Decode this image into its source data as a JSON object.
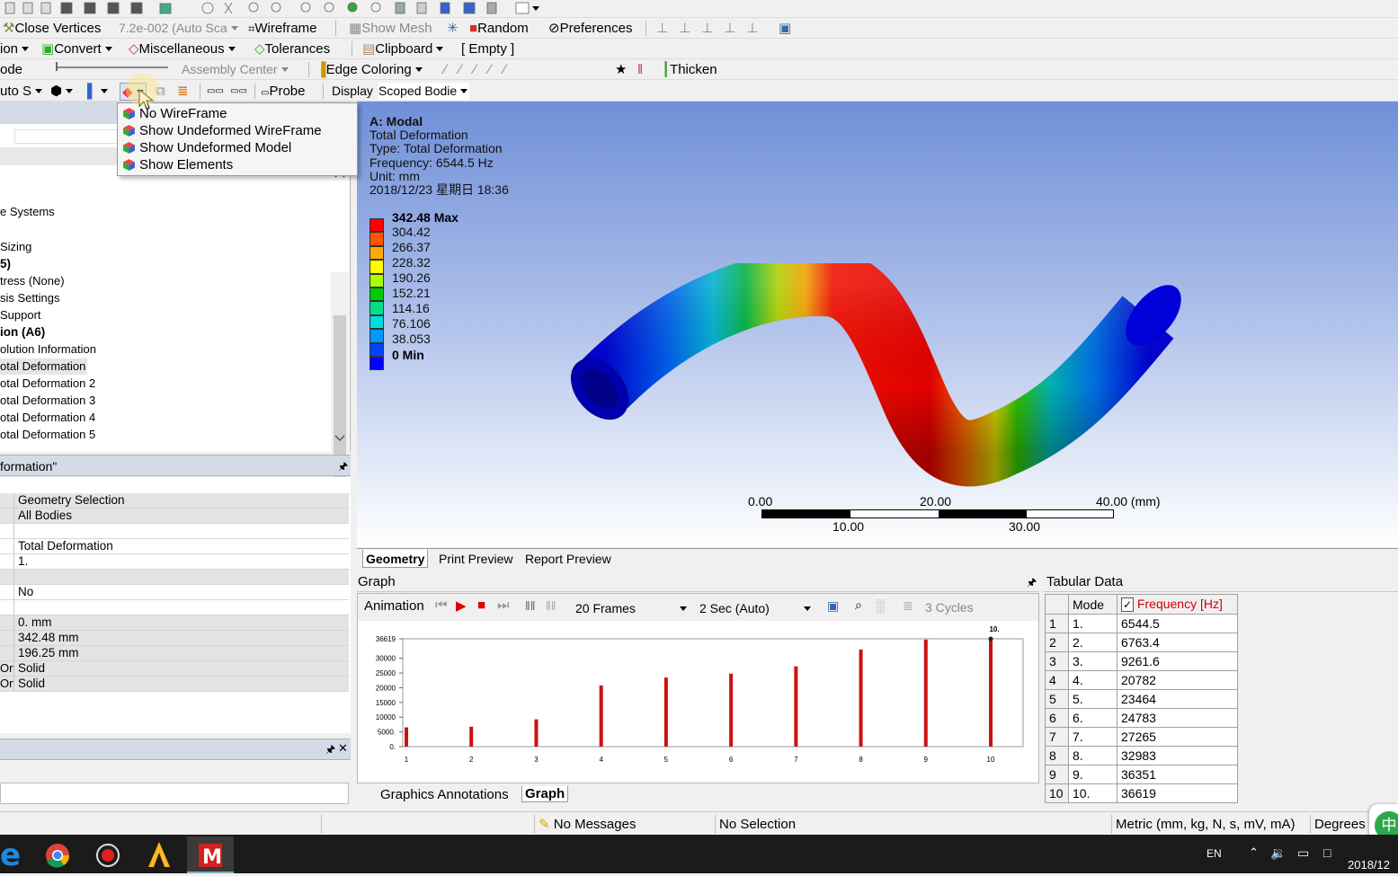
{
  "toolbar_row1": {
    "close_vertices": "Close Vertices",
    "scale_value": "7.2e-002 (Auto Sca",
    "wireframe": "Wireframe",
    "show_mesh": "Show Mesh",
    "random": "Random",
    "preferences": "Preferences"
  },
  "toolbar_row2": {
    "connection": "ion",
    "convert": "Convert",
    "miscellaneous": "Miscellaneous",
    "tolerances": "Tolerances",
    "clipboard": "Clipboard",
    "clipboard_state": "[ Empty ]"
  },
  "toolbar_row3": {
    "mode": "ode",
    "assembly_center": "Assembly Center",
    "edge_coloring": "Edge Coloring",
    "thicken": "Thicken"
  },
  "toolbar_row4": {
    "auto_scale": "uto S",
    "probe": "Probe",
    "display": "Display",
    "scoped_bodies": "Scoped Bodie"
  },
  "wireframe_menu": {
    "items": [
      "No WireFrame",
      "Show Undeformed WireFrame",
      "Show Undeformed Model",
      "Show Elements"
    ]
  },
  "tree": {
    "items": [
      {
        "label": "e Systems",
        "bold": false
      },
      {
        "label": "Sizing",
        "bold": false
      },
      {
        "label": "5)",
        "bold": true
      },
      {
        "label": "tress (None)",
        "bold": false
      },
      {
        "label": "sis Settings",
        "bold": false
      },
      {
        "label": "Support",
        "bold": false
      },
      {
        "label": "ion (A6)",
        "bold": true
      },
      {
        "label": "olution Information",
        "bold": false
      },
      {
        "label": "otal Deformation",
        "bold": false
      },
      {
        "label": "otal Deformation 2",
        "bold": false
      },
      {
        "label": "otal Deformation 3",
        "bold": false
      },
      {
        "label": "otal Deformation 4",
        "bold": false
      },
      {
        "label": "otal Deformation 5",
        "bold": false
      }
    ]
  },
  "details": {
    "title": "formation\"",
    "rows": [
      {
        "key": "",
        "value": "Geometry Selection",
        "shade": true
      },
      {
        "key": "",
        "value": "All Bodies",
        "shade": true
      },
      {
        "key": "",
        "value": "",
        "shade": false
      },
      {
        "key": "",
        "value": "Total Deformation",
        "shade": false
      },
      {
        "key": "",
        "value": "1.",
        "shade": false
      },
      {
        "key": "",
        "value": "",
        "shade": true
      },
      {
        "key": "",
        "value": "No",
        "shade": false
      },
      {
        "key": "",
        "value": "",
        "shade": false
      },
      {
        "key": "",
        "value": "0. mm",
        "shade": true
      },
      {
        "key": "",
        "value": "342.48 mm",
        "shade": true
      },
      {
        "key": "",
        "value": "196.25 mm",
        "shade": true
      },
      {
        "key": "On",
        "value": "Solid",
        "shade": true
      },
      {
        "key": "On",
        "value": "Solid",
        "shade": true
      }
    ]
  },
  "viewport": {
    "title": "A: Modal",
    "result_name": "Total Deformation",
    "type": "Type: Total Deformation",
    "frequency": "Frequency: 6544.5 Hz",
    "unit": "Unit: mm",
    "timestamp": "2018/12/23 星期日 18:36",
    "legend": {
      "max_label": "342.48 Max",
      "min_label": "0 Min",
      "values": [
        "304.42",
        "266.37",
        "228.32",
        "190.26",
        "152.21",
        "114.16",
        "76.106",
        "38.053"
      ],
      "colors": [
        "#ff0000",
        "#ff5500",
        "#ffaa00",
        "#ffff00",
        "#aaff00",
        "#00cc00",
        "#00dd88",
        "#00dddd",
        "#0099ff",
        "#0044ff",
        "#0000ff"
      ]
    },
    "scale_bar": {
      "labels_top": [
        "0.00",
        "20.00",
        "40.00 (mm)"
      ],
      "labels_bottom": [
        "10.00",
        "30.00"
      ]
    }
  },
  "view_tabs": [
    "Geometry",
    "Print Preview",
    "Report Preview"
  ],
  "graph": {
    "title": "Graph",
    "animation_label": "Animation",
    "frames": "20 Frames",
    "duration": "2 Sec (Auto)",
    "cycles": "3 Cycles",
    "tabs": [
      "Graphics Annotations",
      "Graph"
    ]
  },
  "chart_data": {
    "type": "bar",
    "categories": [
      "1",
      "2",
      "3",
      "4",
      "5",
      "6",
      "7",
      "8",
      "9",
      "10"
    ],
    "values": [
      6544.5,
      6763.4,
      9261.6,
      20782,
      23464,
      24783,
      27265,
      32983,
      36351,
      36619
    ],
    "yticks": [
      "0.",
      "5000.",
      "10000",
      "15000",
      "20000",
      "25000",
      "30000",
      "36619"
    ],
    "ylim": [
      0,
      36619
    ],
    "highlight_label": "10.",
    "bar_color": "#cc1111"
  },
  "tabular": {
    "title": "Tabular Data",
    "headers": [
      "Mode",
      "Frequency [Hz]"
    ],
    "rows": [
      [
        "1",
        "1.",
        "6544.5"
      ],
      [
        "2",
        "2.",
        "6763.4"
      ],
      [
        "3",
        "3.",
        "9261.6"
      ],
      [
        "4",
        "4.",
        "20782"
      ],
      [
        "5",
        "5.",
        "23464"
      ],
      [
        "6",
        "6.",
        "24783"
      ],
      [
        "7",
        "7.",
        "27265"
      ],
      [
        "8",
        "8.",
        "32983"
      ],
      [
        "9",
        "9.",
        "36351"
      ],
      [
        "10",
        "10.",
        "36619"
      ]
    ]
  },
  "status": {
    "messages": "No Messages",
    "selection": "No Selection",
    "units": "Metric (mm, kg, N, s, mV, mA)",
    "angle": "Degrees"
  },
  "taskbar": {
    "lang": "EN",
    "date": "2018/12",
    "ime": "中"
  }
}
